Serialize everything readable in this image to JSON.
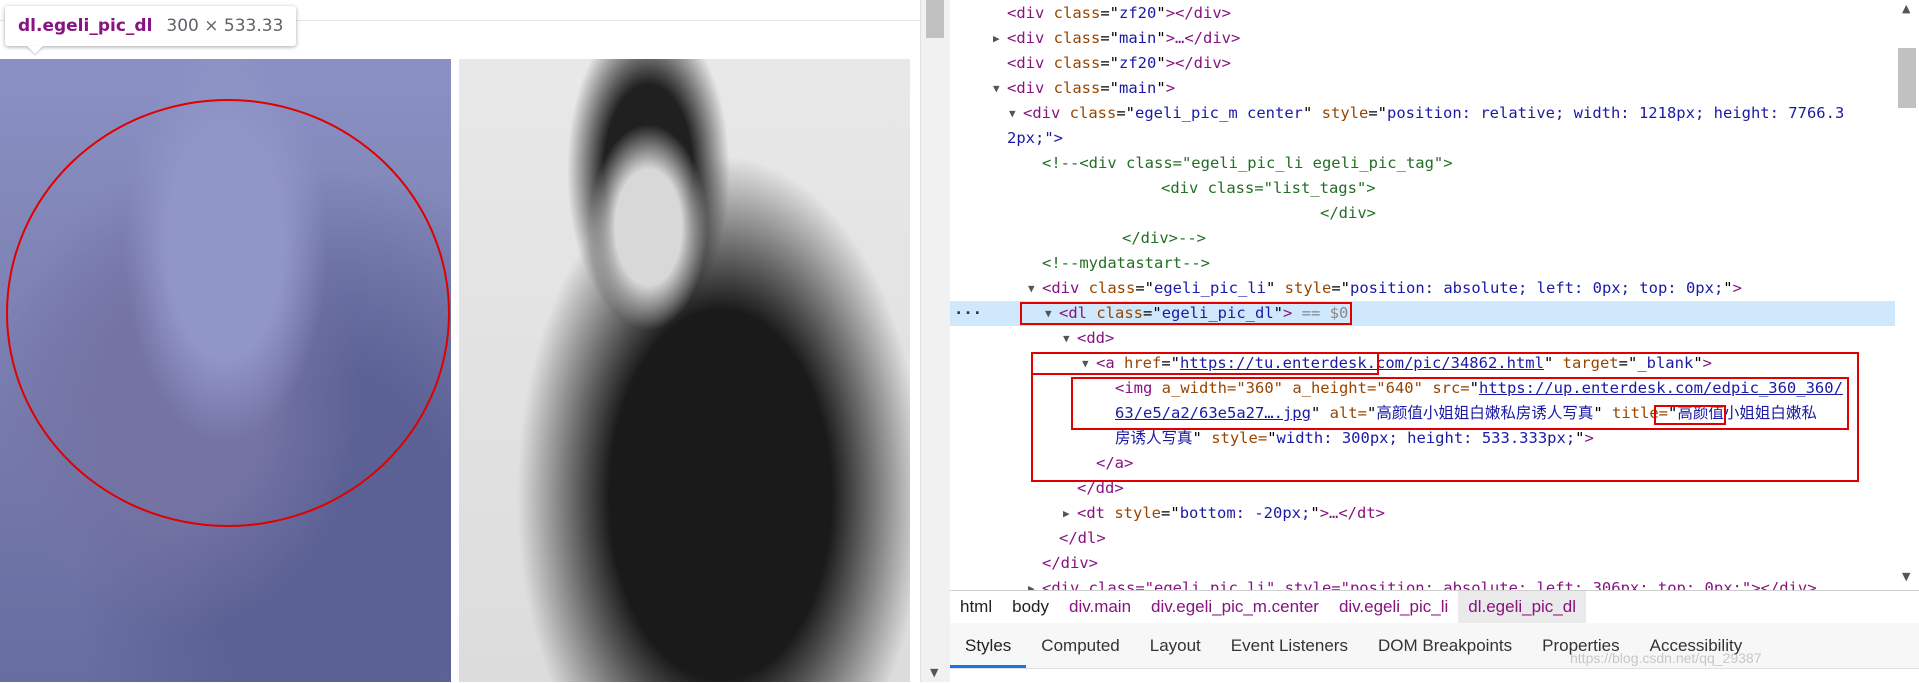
{
  "tooltip": {
    "tag": "dl.egeli_pic_dl",
    "size": "300 × 533.33"
  },
  "tree": {
    "lines": [
      {
        "open": "<div",
        "attrs": [
          {
            "name": "class",
            "value": "zf20"
          }
        ],
        "close": "></div>"
      },
      {
        "open": "<div",
        "attrs": [
          {
            "name": "class",
            "value": "main"
          }
        ],
        "close": ">…</div>"
      },
      {
        "open": "<div",
        "attrs": [
          {
            "name": "class",
            "value": "zf20"
          }
        ],
        "close": "></div>"
      },
      {
        "open": "<div",
        "attrs": [
          {
            "name": "class",
            "value": "main"
          }
        ],
        "close": ">"
      },
      {
        "open": "<div",
        "attrs": [
          {
            "name": "class",
            "value": "egeli_pic_m center"
          },
          {
            "name": "style",
            "value": "position: relative; width: 1218px; height: 7766.3"
          }
        ],
        "close": ""
      },
      {
        "continuation": "2px;\">"
      },
      {
        "comment": "<!--<div class=\"egeli_pic_li egeli_pic_tag\">"
      },
      {
        "comment": "<div class=\"list_tags\">"
      },
      {
        "comment": "</div>"
      },
      {
        "comment": "</div>-->"
      },
      {
        "comment": "<!--mydatastart-->"
      },
      {
        "open": "<div",
        "attrs": [
          {
            "name": "class",
            "value": "egeli_pic_li"
          },
          {
            "name": "style",
            "value": "position: absolute; left: 0px; top: 0px;"
          }
        ],
        "close": ">"
      },
      {
        "open": "<dl",
        "attrs": [
          {
            "name": "class",
            "value": "egeli_pic_dl"
          }
        ],
        "close": ">",
        "selected_suffix": "== $0"
      },
      {
        "open": "<dd>"
      },
      {
        "open": "<a",
        "href": "https://tu.enterdesk.com/pic/34862.html",
        "attrs": [
          {
            "name": "target",
            "value": "_blank"
          }
        ],
        "close": ">"
      },
      {
        "img_prefix": "<img",
        "img_attrs": "a_width=\"360\" a_height=\"640\"",
        "src_label": "src=",
        "src_part1": "https://up.enterdesk.com/edpic_360_360/"
      },
      {
        "src_part2": "63/e5/a2/63e5a27….jpg",
        "alt_label": "alt=",
        "alt_value": "高颜值小姐姐白嫩私房诱人写真",
        "title_label": "title=",
        "title_value": "高颜值小姐姐白嫩私"
      },
      {
        "title_tail": "房诱人写真",
        "style_label": "style=",
        "style_value": "width: 300px; height: 533.333px;",
        "close": ">"
      },
      {
        "close_tag": "</a>"
      },
      {
        "close_tag": "</dd>"
      },
      {
        "open": "<dt",
        "attrs": [
          {
            "name": "style",
            "value": "bottom: -20px;"
          }
        ],
        "close": ">…</dt>"
      },
      {
        "close_tag": "</dl>"
      },
      {
        "close_tag": "</div>"
      },
      {
        "partial": "<div class=\"egeli_pic_li\" style=\"position: absolute; left: 306px; top: 0px;\"></div>"
      }
    ]
  },
  "breadcrumb": [
    "html",
    "body",
    "div.main",
    "div.egeli_pic_m.center",
    "div.egeli_pic_li",
    "dl.egeli_pic_dl"
  ],
  "subtabs": [
    "Styles",
    "Computed",
    "Layout",
    "Event Listeners",
    "DOM Breakpoints",
    "Properties",
    "Accessibility"
  ],
  "watermark": "https://blog.csdn.net/qq_29387"
}
